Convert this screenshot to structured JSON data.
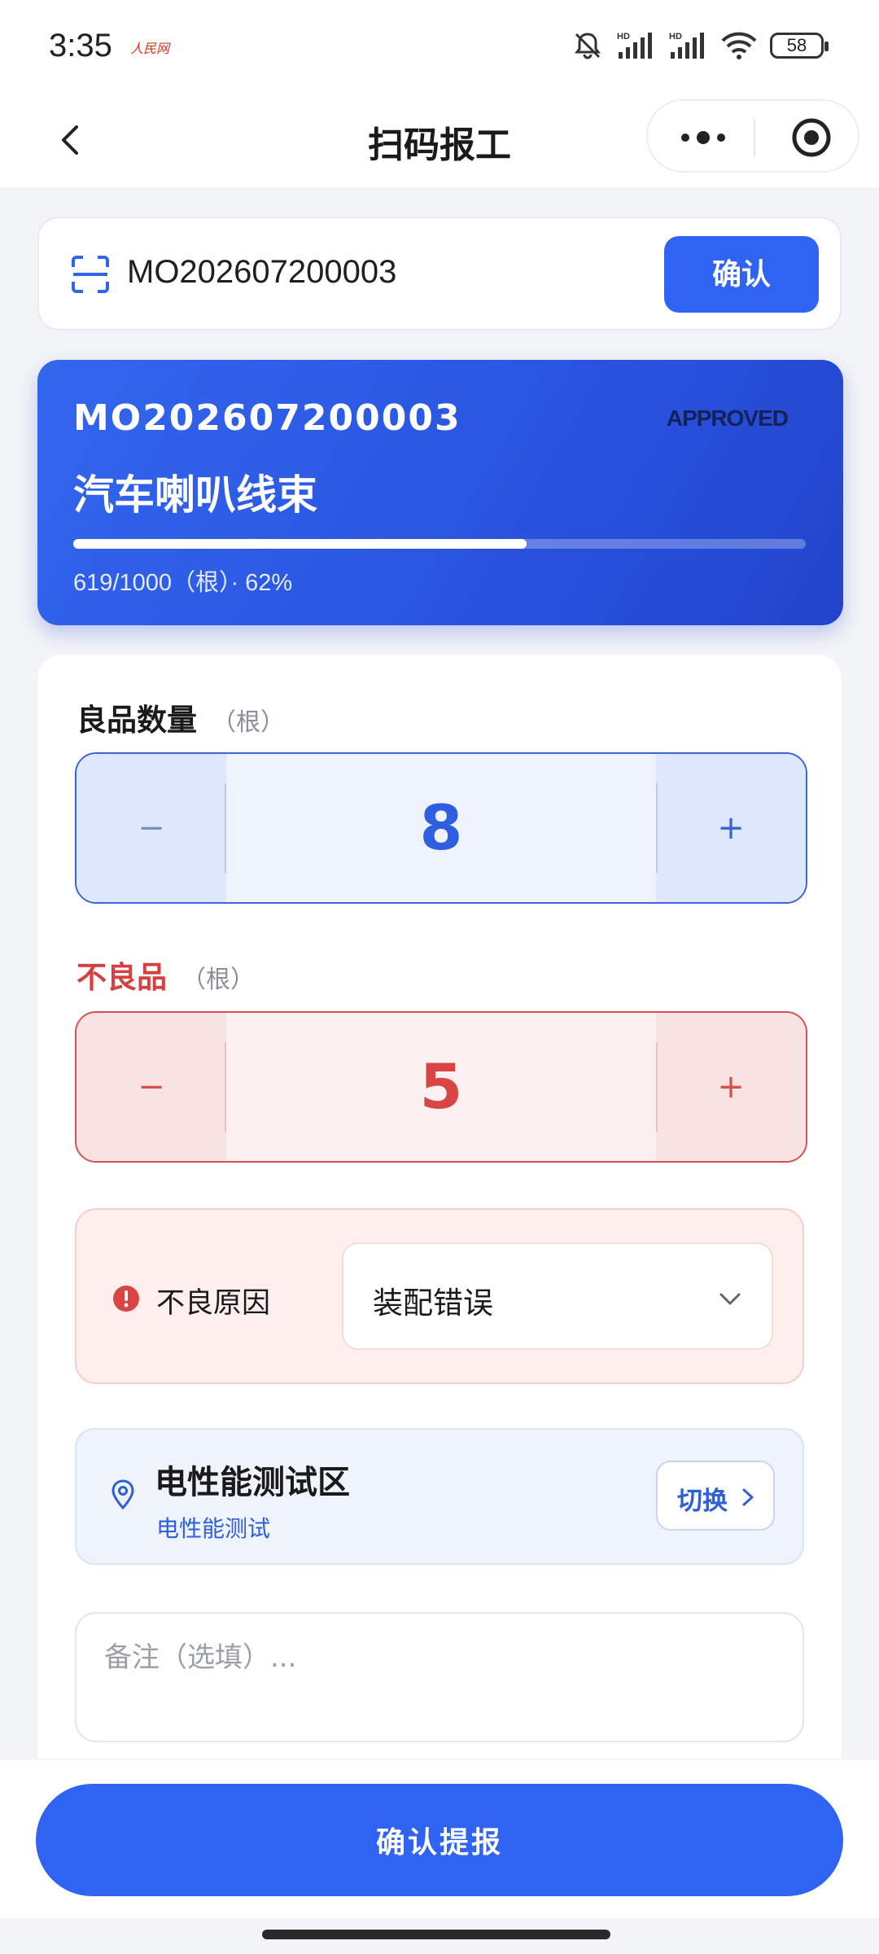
{
  "status_bar": {
    "time": "3:35",
    "carrier_text": "人民网",
    "battery": "58",
    "network_badges": [
      "HD",
      "HD"
    ]
  },
  "navbar": {
    "title": "扫码报工",
    "back_icon": "chevron-left-icon",
    "more_icon": "more-dots-icon",
    "close_icon": "target-circle-icon"
  },
  "scan": {
    "value": "MO202607200003",
    "confirm_label": "确认"
  },
  "order": {
    "code": "MO202607200003",
    "status": "APPROVED",
    "product_name": "汽车喇叭线束",
    "progress_text": "619/1000（根）· 62%",
    "progress_fraction": 0.619
  },
  "good": {
    "label": "良品数量",
    "unit": "（根）",
    "value": "8",
    "minus": "−",
    "plus": "+"
  },
  "bad": {
    "label": "不良品",
    "unit": "（根）",
    "value": "5",
    "minus": "−",
    "plus": "+"
  },
  "reason": {
    "label": "不良原因",
    "selected": "装配错误"
  },
  "location": {
    "title": "电性能测试区",
    "subtitle": "电性能测试",
    "switch_label": "切换"
  },
  "remark": {
    "placeholder": "备注（选填）..."
  },
  "submit": {
    "label": "确认提报"
  },
  "colors": {
    "primary": "#2f63f2",
    "danger": "#d64040",
    "background": "#f3f4f7"
  }
}
